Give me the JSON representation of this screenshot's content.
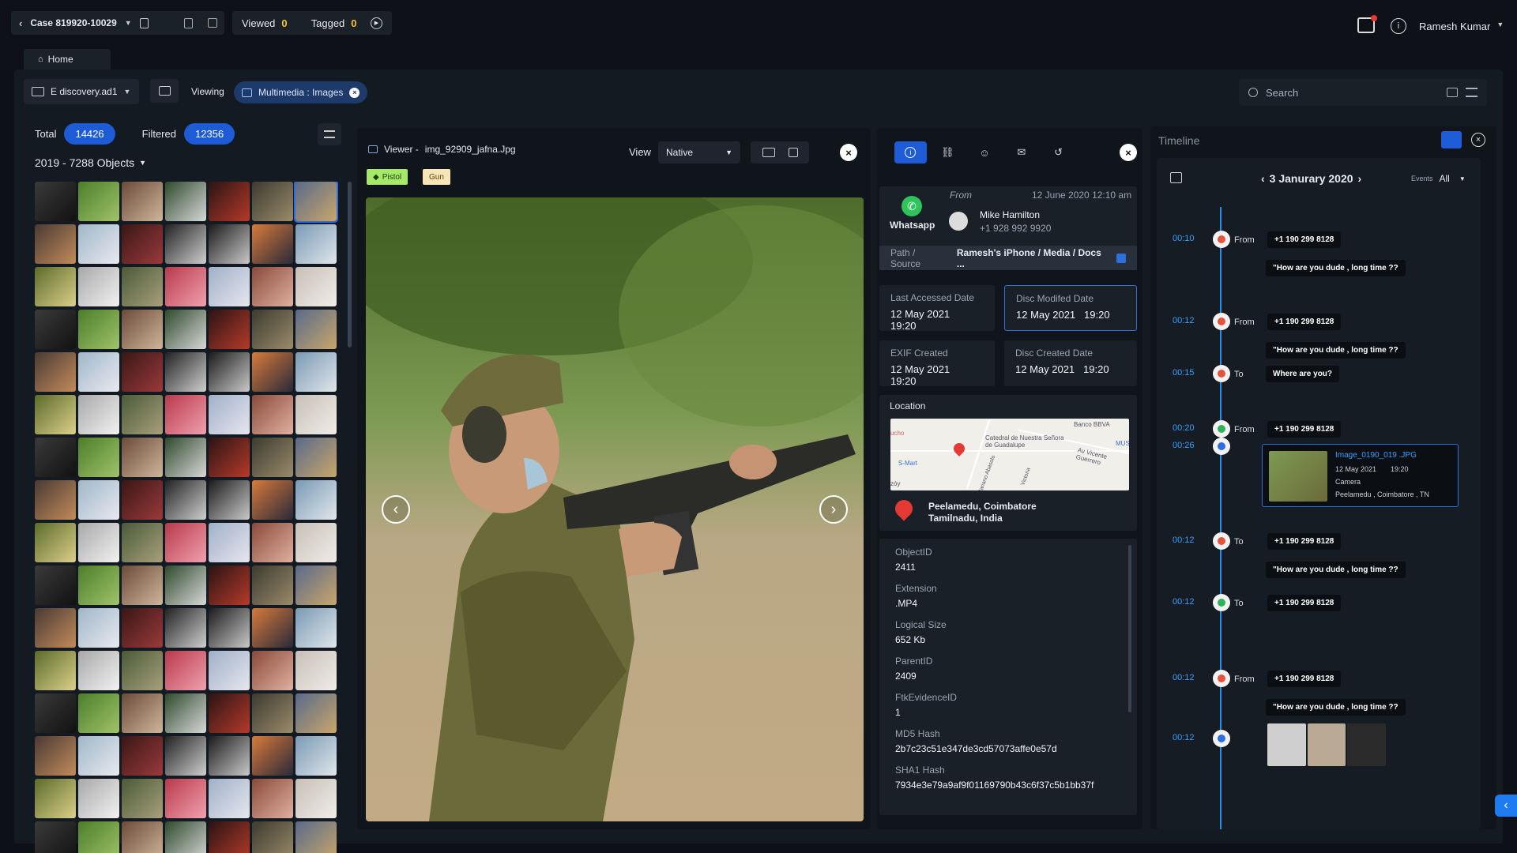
{
  "topbar": {
    "case_label": "Case 819920-10029",
    "viewed_label": "Viewed",
    "viewed_count": "0",
    "tagged_label": "Tagged",
    "tagged_count": "0",
    "user_name": "Ramesh Kumar"
  },
  "tabs": {
    "home": "Home"
  },
  "filterbar": {
    "source": "E discovery.ad1",
    "viewing_label": "Viewing",
    "chip": "Multimedia : Images",
    "search_placeholder": "Search"
  },
  "left": {
    "total_label": "Total",
    "total": "14426",
    "filtered_label": "Filtered",
    "filtered": "12356",
    "group_title": "2019 - 7288 Objects"
  },
  "viewer": {
    "title_prefix": "Viewer -",
    "filename": "img_92909_jafna.Jpg",
    "view_label": "View",
    "view_mode": "Native",
    "tags": [
      "Pistol",
      "Gun"
    ]
  },
  "info": {
    "app": "Whatsapp",
    "from_label": "From",
    "timestamp": "12 June 2020 12:10 am",
    "contact_name": "Mike Hamilton",
    "contact_phone": "+1 928 992 9920",
    "path_label": "Path / Source",
    "path_value": "Ramesh's iPhone / Media / Docs ...",
    "dates": [
      {
        "label": "Last Accessed Date",
        "date": "12 May 2021",
        "time": "19:20"
      },
      {
        "label": "Disc Modifed Date",
        "date": "12 May 2021",
        "time": "19:20"
      },
      {
        "label": "EXIF Created",
        "date": "12 May 2021",
        "time": "19:20"
      },
      {
        "label": "Disc Created Date",
        "date": "12 May 2021",
        "time": "19:20"
      }
    ],
    "location_label": "Location",
    "map_labels": [
      "Banco BBVA",
      "Catedral de Nuestra Señora de Guadalupe",
      "Av Vicente Guerrero",
      "S-Mart",
      "MUS",
      "Mariano Abasolo",
      "Victoria",
      "ucho",
      "zóy"
    ],
    "location_line1": "Peelamedu, Coimbatore",
    "location_line2": "Tamilnadu, India",
    "meta": [
      {
        "label": "ObjectID",
        "value": "2411"
      },
      {
        "label": "Extension",
        "value": ".MP4"
      },
      {
        "label": "Logical Size",
        "value": "652 Kb"
      },
      {
        "label": "ParentID",
        "value": "2409"
      },
      {
        "label": "FtkEvidenceID",
        "value": "1"
      },
      {
        "label": "MD5 Hash",
        "value": "2b7c23c51e347de3cd57073affe0e57d"
      },
      {
        "label": "SHA1 Hash",
        "value": "7934e3e79a9af9f01169790b43c6f37c5b1bb37f"
      }
    ]
  },
  "timeline": {
    "title": "Timeline",
    "date": "3 Janurary 2020",
    "events_label": "Events",
    "events_value": "All",
    "entries": [
      {
        "time": "00:10",
        "kind": "From",
        "number": "+1 190 299 8128",
        "message": "\"How are you dude , long time ??"
      },
      {
        "time": "00:12",
        "kind": "From",
        "number": "+1 190 299 8128",
        "message": "\"How are you dude , long time ??"
      },
      {
        "time": "00:15",
        "kind": "To",
        "message": "Where are you?"
      },
      {
        "time": "00:20",
        "kind": "From",
        "number": "+1 190 299 8128"
      },
      {
        "time": "00:26",
        "image_name": "Image_0190_019 .JPG",
        "image_date": "12 May 2021",
        "image_time": "19:20",
        "image_source": "Camera",
        "image_location": "Peelamedu , Coimbatore , TN"
      },
      {
        "time": "00:12",
        "kind": "To",
        "number": "+1 190 299 8128",
        "message": "\"How are you dude , long time ??"
      },
      {
        "time": "00:12",
        "kind": "To",
        "number": "+1 190 299 8128"
      },
      {
        "time": "00:12",
        "kind": "From",
        "number": "+1 190 299 8128",
        "message": "\"How are you dude , long time ??"
      },
      {
        "time": "00:12"
      }
    ]
  },
  "colors": {
    "accent": "#1e5bd6",
    "link": "#3aa0ff",
    "highlight": "#f5c518",
    "timeline_line": "#2b8fe6"
  }
}
